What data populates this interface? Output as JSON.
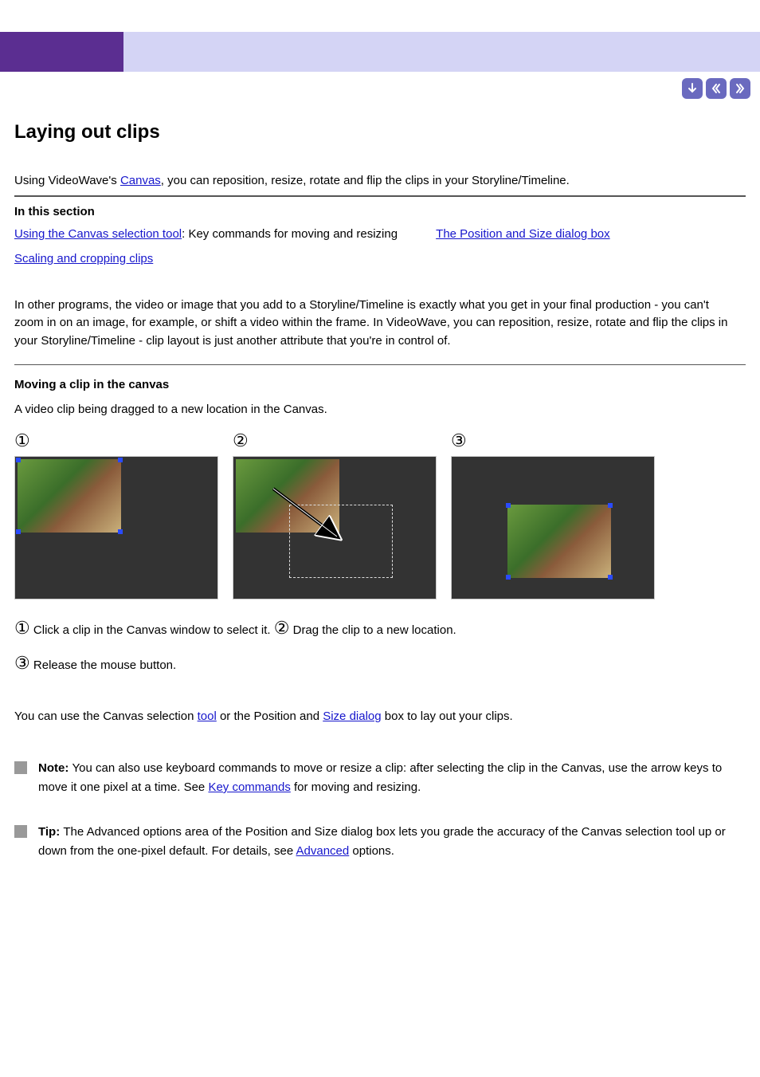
{
  "title": "Laying out clips",
  "intro_prefix": "Using VideoWave's ",
  "intro_link": "Canvas",
  "intro_suffix": ", you can reposition, resize, rotate and flip the clips in your Storyline/Timeline.",
  "subheading": "In this section",
  "links": {
    "using_tool": "Using the Canvas selection tool",
    "key_cmd": ": Key commands for moving and resizing",
    "dialog": "The Position and Size dialog box",
    "scale_crop": "Scaling and cropping clips"
  },
  "body1": "In other programs, the video or image that you add to a Storyline/Timeline is exactly what you get in your final production - you can't zoom in on an image, for example, or shift a video within the frame. In VideoWave, you can reposition, resize, rotate and flip the clips in your Storyline/Timeline - clip layout is just another attribute that you're in control of.",
  "section_title": "Moving a clip in the canvas",
  "section_desc": "A video clip being dragged to a new location in the Canvas.",
  "caption1_num": "①",
  "caption1_text": " Click a clip in the Canvas window to select it.  ",
  "caption2_num": "②",
  "caption2_text": " Drag the clip to a new location.  ",
  "caption3_num": "③",
  "caption3_text": " Release the mouse button.",
  "canvas_note_prefix": "You can use the Canvas selection ",
  "canvas_note_link1": "tool",
  "canvas_note_mid": " or the Position and ",
  "canvas_note_link2": "Size dialog",
  "canvas_note_suffix": " box to lay out your clips.",
  "note_title": "Note: ",
  "note_text": "You can also use keyboard commands to move or resize a clip: after selecting the clip in the Canvas, use the arrow keys to move it one pixel at a time. See ",
  "note_link": "Key commands",
  "note_after": " for moving and resizing.",
  "tip_title": "Tip: ",
  "tip_text": "The Advanced options area of the Position and Size dialog box lets you grade the accuracy of the Canvas selection tool up or down from the one-pixel default. For details, see ",
  "tip_link": "Advanced",
  "tip_after": " options."
}
